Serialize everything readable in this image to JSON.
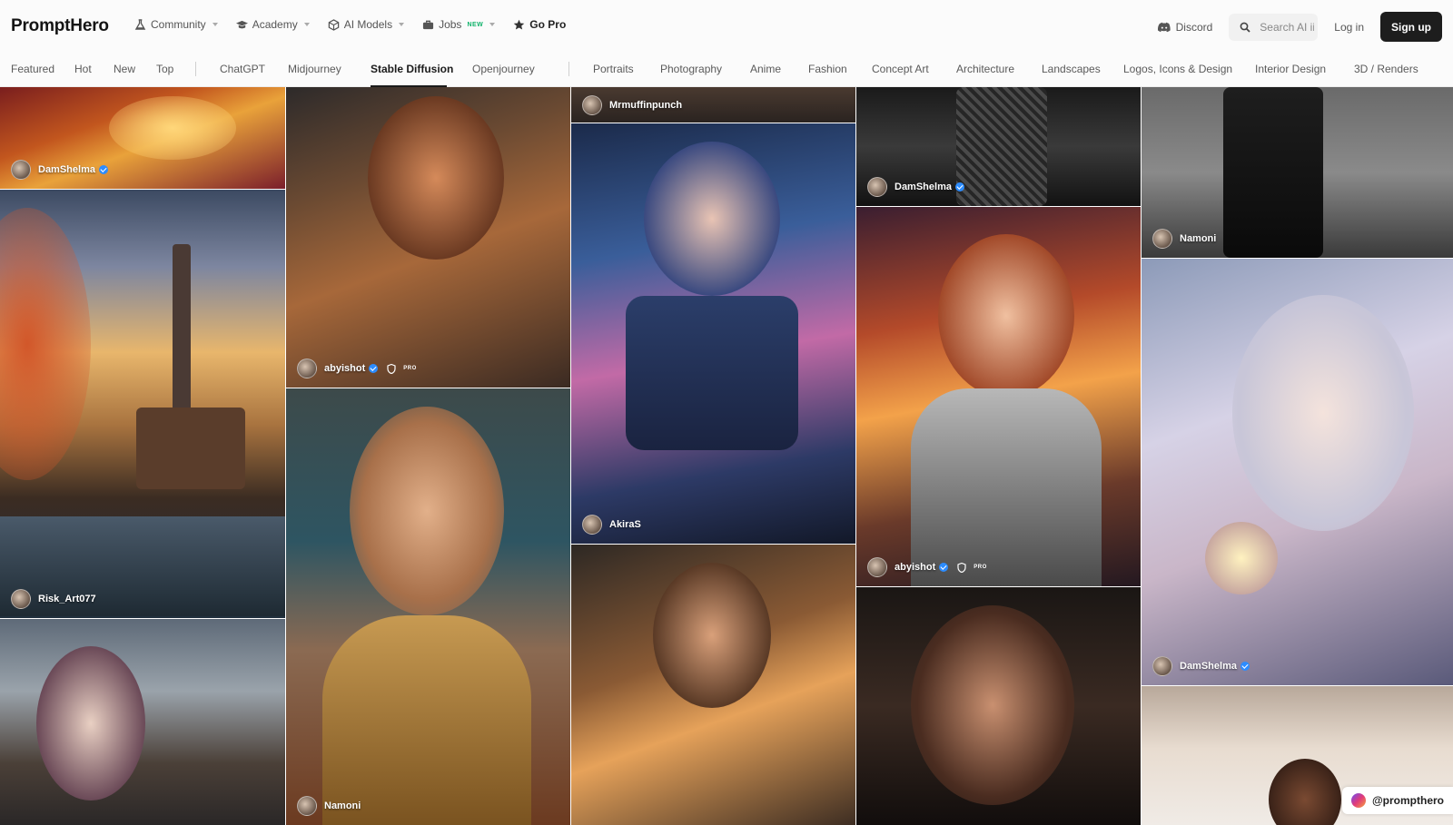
{
  "brand": {
    "name": "PromptHero"
  },
  "topnav": {
    "items": [
      {
        "label": "Community",
        "icon": "flask-icon"
      },
      {
        "label": "Academy",
        "icon": "graduation-cap-icon"
      },
      {
        "label": "AI Models",
        "icon": "cube-icon"
      },
      {
        "label": "Jobs",
        "icon": "briefcase-icon",
        "badge": "NEW"
      },
      {
        "label": "Go Pro",
        "icon": "star-icon"
      }
    ]
  },
  "actions": {
    "discord": "Discord",
    "search_placeholder": "Search AI ii",
    "login": "Log in",
    "signup": "Sign up"
  },
  "categories": {
    "sort": [
      "Featured",
      "Hot",
      "New",
      "Top"
    ],
    "models": [
      "ChatGPT",
      "Midjourney",
      "Stable Diffusion",
      "Openjourney"
    ],
    "topics": [
      "Portraits",
      "Photography",
      "Anime",
      "Fashion",
      "Concept Art",
      "Architecture",
      "Landscapes",
      "Logos, Icons & Design",
      "Interior Design",
      "3D / Renders"
    ],
    "active": "Stable Diffusion"
  },
  "cards": [
    {
      "user": "DamShelma",
      "verified": true,
      "pro": false
    },
    {
      "user": "Risk_Art077",
      "verified": false,
      "pro": false
    },
    {
      "user": "abyishot",
      "verified": true,
      "pro": true,
      "pro_label": "PRO"
    },
    {
      "user": "Namoni",
      "verified": false,
      "pro": false
    },
    {
      "user": "Mrmuffinpunch",
      "verified": false,
      "pro": false
    },
    {
      "user": "AkiraS",
      "verified": false,
      "pro": false
    },
    {
      "user": "DamShelma",
      "verified": true,
      "pro": false
    },
    {
      "user": "abyishot",
      "verified": true,
      "pro": true,
      "pro_label": "PRO"
    },
    {
      "user": "Namoni",
      "verified": false,
      "pro": false
    },
    {
      "user": "DamShelma",
      "verified": true,
      "pro": false
    }
  ],
  "social_handle": "@prompthero"
}
